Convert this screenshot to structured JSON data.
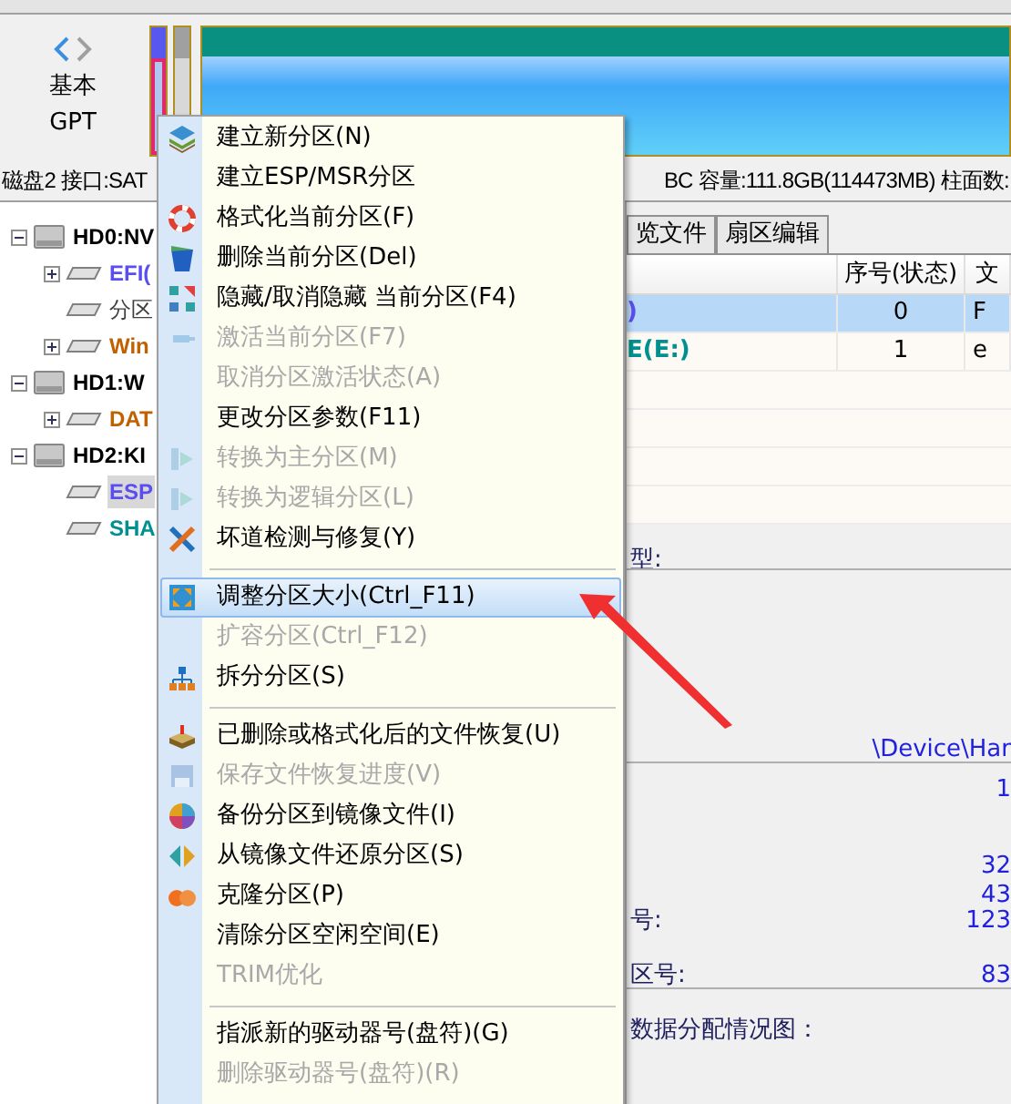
{
  "nav": {
    "line1": "基本",
    "line2": "GPT"
  },
  "disk_info": {
    "left": "磁盘2 接口:SAT",
    "right": "BC  容量:111.8GB(114473MB)  柱面数:"
  },
  "tree": [
    {
      "label": "HD0:NV",
      "color": "#000000",
      "expanded": true,
      "selected": false,
      "children": [
        {
          "label": "EFI(",
          "color": "#5b4ef0",
          "expanded": false,
          "selected": false
        },
        {
          "label": "分区",
          "color": "#404040",
          "selected": false
        },
        {
          "label": "Win",
          "color": "#c06000",
          "expanded": false,
          "selected": false
        }
      ]
    },
    {
      "label": "HD1:W",
      "color": "#000000",
      "expanded": true,
      "selected": false,
      "children": [
        {
          "label": "DAT",
          "color": "#c06000",
          "expanded": false,
          "selected": false
        }
      ]
    },
    {
      "label": "HD2:KI",
      "color": "#000000",
      "expanded": true,
      "selected": false,
      "children": [
        {
          "label": "ESP",
          "color": "#5b4ef0",
          "selected": true
        },
        {
          "label": "SHA",
          "color": "#009090",
          "selected": false
        }
      ]
    }
  ],
  "tabs": [
    {
      "label": "览文件",
      "selected": false
    },
    {
      "label": "扇区编辑",
      "selected": false
    }
  ],
  "table": {
    "columns": [
      "",
      "序号(状态)",
      "文"
    ],
    "rows": [
      {
        "cells": [
          ")",
          "0",
          "F"
        ],
        "color": "#5b4ef0",
        "selected": true
      },
      {
        "cells": [
          "E(E:)",
          "1",
          "e"
        ],
        "color": "#009090",
        "selected": false
      }
    ]
  },
  "details": [
    {
      "label": "型:"
    },
    {
      "value": "\\Device\\Har"
    },
    {
      "value": "1"
    },
    {
      "value": "32"
    },
    {
      "value": "43"
    },
    {
      "label": "号:",
      "value": "123"
    },
    {
      "label": "区号:",
      "value": "83"
    },
    {
      "label": "数据分配情况图："
    }
  ],
  "context_menu": {
    "items": [
      {
        "kind": "item",
        "label": "建立新分区(N)",
        "disabled": false,
        "selected": false
      },
      {
        "kind": "item",
        "label": "建立ESP/MSR分区",
        "disabled": false,
        "selected": false
      },
      {
        "kind": "item",
        "label": "格式化当前分区(F)",
        "disabled": false,
        "selected": false
      },
      {
        "kind": "item",
        "label": "删除当前分区(Del)",
        "disabled": false,
        "selected": false
      },
      {
        "kind": "item",
        "label": "隐藏/取消隐藏 当前分区(F4)",
        "disabled": false,
        "selected": false
      },
      {
        "kind": "item",
        "label": "激活当前分区(F7)",
        "disabled": true,
        "selected": false
      },
      {
        "kind": "item",
        "label": "取消分区激活状态(A)",
        "disabled": true,
        "selected": false
      },
      {
        "kind": "item",
        "label": "更改分区参数(F11)",
        "disabled": false,
        "selected": false
      },
      {
        "kind": "item",
        "label": "转换为主分区(M)",
        "disabled": true,
        "selected": false
      },
      {
        "kind": "item",
        "label": "转换为逻辑分区(L)",
        "disabled": true,
        "selected": false
      },
      {
        "kind": "item",
        "label": "坏道检测与修复(Y)",
        "disabled": false,
        "selected": false
      },
      {
        "kind": "separator"
      },
      {
        "kind": "item",
        "label": "调整分区大小(Ctrl_F11)",
        "disabled": false,
        "selected": true
      },
      {
        "kind": "item",
        "label": "扩容分区(Ctrl_F12)",
        "disabled": true,
        "selected": false
      },
      {
        "kind": "item",
        "label": "拆分分区(S)",
        "disabled": false,
        "selected": false
      },
      {
        "kind": "separator"
      },
      {
        "kind": "item",
        "label": "已删除或格式化后的文件恢复(U)",
        "disabled": false,
        "selected": false
      },
      {
        "kind": "item",
        "label": "保存文件恢复进度(V)",
        "disabled": true,
        "selected": false
      },
      {
        "kind": "item",
        "label": "备份分区到镜像文件(I)",
        "disabled": false,
        "selected": false
      },
      {
        "kind": "item",
        "label": "从镜像文件还原分区(S)",
        "disabled": false,
        "selected": false
      },
      {
        "kind": "item",
        "label": "克隆分区(P)",
        "disabled": false,
        "selected": false
      },
      {
        "kind": "item",
        "label": "清除分区空闲空间(E)",
        "disabled": false,
        "selected": false
      },
      {
        "kind": "item",
        "label": "TRIM优化",
        "disabled": true,
        "selected": false
      },
      {
        "kind": "separator"
      },
      {
        "kind": "item",
        "label": "指派新的驱动器号(盘符)(G)",
        "disabled": false,
        "selected": false
      },
      {
        "kind": "item",
        "label": "删除驱动器号(盘符)(R)",
        "disabled": true,
        "selected": false
      }
    ]
  }
}
